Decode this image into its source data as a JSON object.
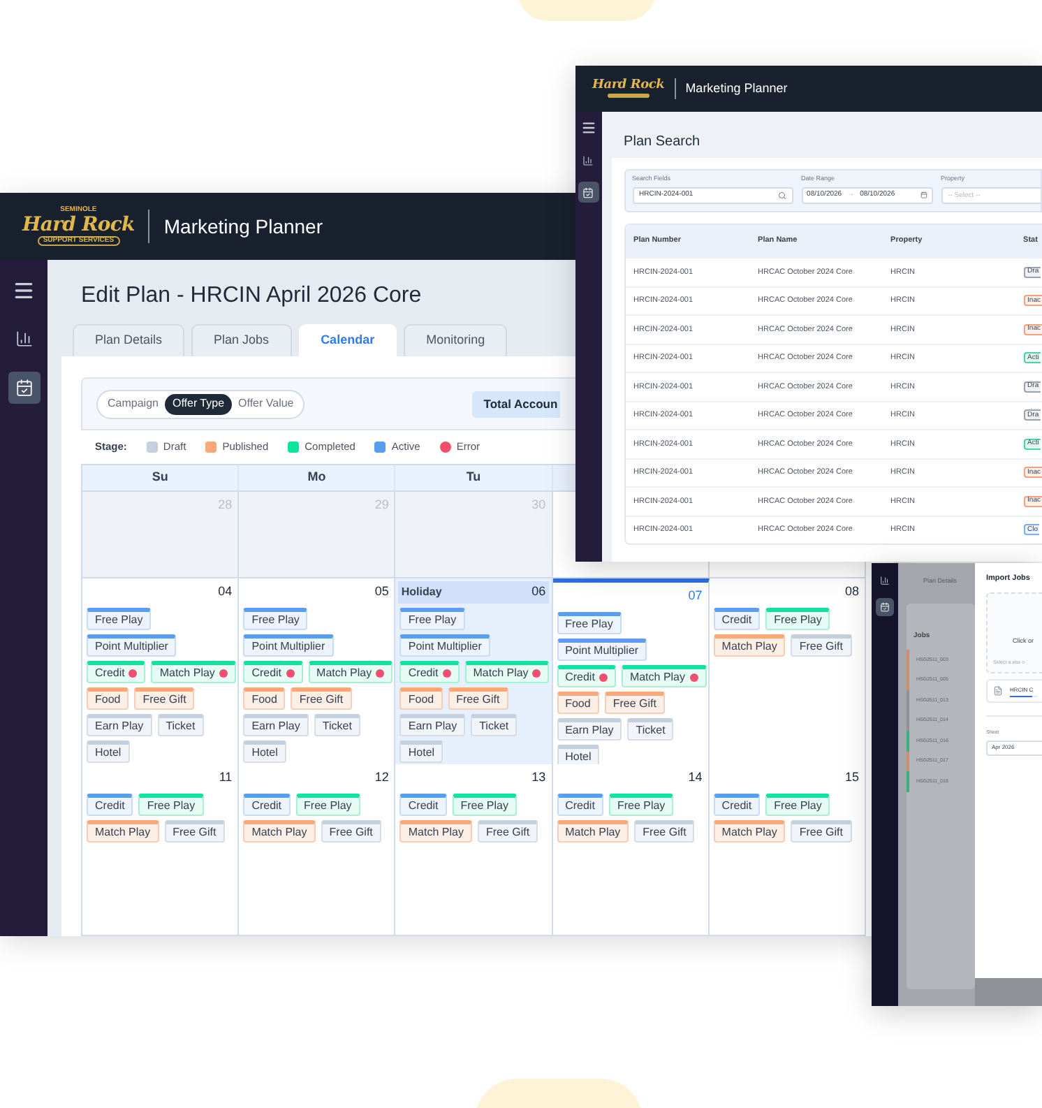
{
  "main_window": {
    "logo": {
      "top": "SEMINOLE",
      "main": "Hard Rock",
      "bottom": "SUPPORT SERVICES"
    },
    "app_title": "Marketing Planner",
    "sidebar": [
      {
        "selected": false
      },
      {
        "selected": false
      },
      {
        "selected": true
      }
    ],
    "page_title": "Edit Plan - HRCIN April 2026 Core",
    "tabs": [
      {
        "label": "Plan Details",
        "selected": false
      },
      {
        "label": "Plan Jobs",
        "selected": false
      },
      {
        "label": "Calendar",
        "selected": true
      },
      {
        "label": "Monitoring",
        "selected": false
      }
    ],
    "view_toggle": [
      {
        "label": "Campaign",
        "selected": false
      },
      {
        "label": "Offer Type",
        "selected": true
      },
      {
        "label": "Offer Value",
        "selected": false
      }
    ],
    "total_button": "Total Accoun",
    "legend": {
      "label": "Stage:",
      "items": [
        {
          "label": "Draft",
          "kind": "draft"
        },
        {
          "label": "Published",
          "kind": "published"
        },
        {
          "label": "Completed",
          "kind": "completed"
        },
        {
          "label": "Active",
          "kind": "active"
        },
        {
          "label": "Error",
          "kind": "error"
        }
      ]
    },
    "weekdays": [
      "Su",
      "Mo",
      "Tu"
    ],
    "weeks": [
      {
        "days": [
          {
            "date": "28",
            "muted": true,
            "today": false
          },
          {
            "date": "29",
            "muted": true,
            "today": false
          },
          {
            "date": "30",
            "muted": true,
            "today": false
          }
        ]
      },
      {
        "days": [
          {
            "date": "04",
            "muted": false,
            "today": false,
            "lines": [
              [
                {
                  "label": "Free Play",
                  "kind": "active",
                  "error": false
                }
              ],
              [
                {
                  "label": "Point Multiplier",
                  "kind": "active",
                  "error": false
                }
              ],
              [
                {
                  "label": "Credit",
                  "kind": "completed",
                  "error": true
                },
                {
                  "label": "Match Play",
                  "kind": "completed",
                  "error": true
                }
              ],
              [
                {
                  "label": "Food",
                  "kind": "published",
                  "error": false
                },
                {
                  "label": "Free Gift",
                  "kind": "published",
                  "error": false
                }
              ],
              [
                {
                  "label": "Earn Play",
                  "kind": "draft",
                  "error": false
                },
                {
                  "label": "Ticket",
                  "kind": "draft",
                  "error": false
                }
              ],
              [
                {
                  "label": "Hotel",
                  "kind": "draft",
                  "error": false
                }
              ]
            ]
          },
          {
            "date": "05",
            "muted": false,
            "today": false,
            "lines": [
              [
                {
                  "label": "Free Play",
                  "kind": "active",
                  "error": false
                }
              ],
              [
                {
                  "label": "Point Multiplier",
                  "kind": "active",
                  "error": false
                }
              ],
              [
                {
                  "label": "Credit",
                  "kind": "completed",
                  "error": true
                },
                {
                  "label": "Match Play",
                  "kind": "completed",
                  "error": true
                }
              ],
              [
                {
                  "label": "Food",
                  "kind": "published",
                  "error": false
                },
                {
                  "label": "Free Gift",
                  "kind": "published",
                  "error": false
                }
              ],
              [
                {
                  "label": "Earn Play",
                  "kind": "draft",
                  "error": false
                },
                {
                  "label": "Ticket",
                  "kind": "draft",
                  "error": false
                }
              ],
              [
                {
                  "label": "Hotel",
                  "kind": "draft",
                  "error": false
                }
              ]
            ]
          },
          {
            "date": "06",
            "holiday": "Holiday",
            "muted": false,
            "today": false,
            "lines": [
              [
                {
                  "label": "Free Play",
                  "kind": "active",
                  "error": false
                }
              ],
              [
                {
                  "label": "Point Multiplier",
                  "kind": "active",
                  "error": false
                }
              ],
              [
                {
                  "label": "Credit",
                  "kind": "completed",
                  "error": true
                },
                {
                  "label": "Match Play",
                  "kind": "completed",
                  "error": true
                }
              ],
              [
                {
                  "label": "Food",
                  "kind": "published",
                  "error": false
                },
                {
                  "label": "Free Gift",
                  "kind": "published",
                  "error": false
                }
              ],
              [
                {
                  "label": "Earn Play",
                  "kind": "draft",
                  "error": false
                },
                {
                  "label": "Ticket",
                  "kind": "draft",
                  "error": false
                }
              ],
              [
                {
                  "label": "Hotel",
                  "kind": "draft",
                  "error": false
                }
              ]
            ]
          },
          {
            "date": "07",
            "muted": false,
            "today": true,
            "lines": [
              [
                {
                  "label": "Free Play",
                  "kind": "active",
                  "error": false
                }
              ],
              [
                {
                  "label": "Point Multiplier",
                  "kind": "active",
                  "error": false
                }
              ],
              [
                {
                  "label": "Credit",
                  "kind": "completed",
                  "error": true
                },
                {
                  "label": "Match Play",
                  "kind": "completed",
                  "error": true
                }
              ],
              [
                {
                  "label": "Food",
                  "kind": "published",
                  "error": false
                },
                {
                  "label": "Free Gift",
                  "kind": "published",
                  "error": false
                }
              ],
              [
                {
                  "label": "Earn Play",
                  "kind": "draft",
                  "error": false
                },
                {
                  "label": "Ticket",
                  "kind": "draft",
                  "error": false
                }
              ],
              [
                {
                  "label": "Hotel",
                  "kind": "draft",
                  "error": false
                }
              ]
            ]
          },
          {
            "date": "08",
            "muted": false,
            "today": false,
            "lines": [
              [
                {
                  "label": "Credit",
                  "kind": "active",
                  "error": false
                },
                {
                  "label": "Free Play",
                  "kind": "completed",
                  "error": false
                }
              ],
              [
                {
                  "label": "Match Play",
                  "kind": "published",
                  "error": false
                },
                {
                  "label": "Free Gift",
                  "kind": "draft",
                  "error": false
                }
              ]
            ]
          }
        ]
      },
      {
        "days": [
          {
            "date": "11",
            "muted": false,
            "today": false,
            "lines": [
              [
                {
                  "label": "Credit",
                  "kind": "active",
                  "error": false
                },
                {
                  "label": "Free Play",
                  "kind": "completed",
                  "error": false
                }
              ],
              [
                {
                  "label": "Match Play",
                  "kind": "published",
                  "error": false
                },
                {
                  "label": "Free Gift",
                  "kind": "draft",
                  "error": false
                }
              ]
            ]
          },
          {
            "date": "12",
            "muted": false,
            "today": false,
            "lines": [
              [
                {
                  "label": "Credit",
                  "kind": "active",
                  "error": false
                },
                {
                  "label": "Free Play",
                  "kind": "completed",
                  "error": false
                }
              ],
              [
                {
                  "label": "Match Play",
                  "kind": "published",
                  "error": false
                },
                {
                  "label": "Free Gift",
                  "kind": "draft",
                  "error": false
                }
              ]
            ]
          },
          {
            "date": "13",
            "muted": false,
            "today": false,
            "lines": [
              [
                {
                  "label": "Credit",
                  "kind": "active",
                  "error": false
                },
                {
                  "label": "Free Play",
                  "kind": "completed",
                  "error": false
                }
              ],
              [
                {
                  "label": "Match Play",
                  "kind": "published",
                  "error": false
                },
                {
                  "label": "Free Gift",
                  "kind": "draft",
                  "error": false
                }
              ]
            ]
          },
          {
            "date": "14",
            "muted": false,
            "today": false,
            "lines": [
              [
                {
                  "label": "Credit",
                  "kind": "active",
                  "error": false
                },
                {
                  "label": "Free Play",
                  "kind": "completed",
                  "error": false
                }
              ],
              [
                {
                  "label": "Match Play",
                  "kind": "published",
                  "error": false
                },
                {
                  "label": "Free Gift",
                  "kind": "draft",
                  "error": false
                }
              ]
            ]
          },
          {
            "date": "15",
            "muted": false,
            "today": false,
            "lines": [
              [
                {
                  "label": "Credit",
                  "kind": "active",
                  "error": false
                },
                {
                  "label": "Free Play",
                  "kind": "completed",
                  "error": false
                }
              ],
              [
                {
                  "label": "Match Play",
                  "kind": "published",
                  "error": false
                },
                {
                  "label": "Free Gift",
                  "kind": "draft",
                  "error": false
                }
              ]
            ]
          }
        ]
      }
    ]
  },
  "search_window": {
    "logo": {
      "main": "Hard Rock"
    },
    "app_title": "Marketing Planner",
    "sidebar": [
      {
        "selected": false
      },
      {
        "selected": false
      },
      {
        "selected": true
      }
    ],
    "page_title": "Plan Search",
    "filters": {
      "search_label": "Search Fields",
      "search_value": "HRCIN-2024-001",
      "date_label": "Date Range",
      "date_from": "08/10/2026",
      "date_arrow": "→",
      "date_to": "08/10/2026",
      "property_label": "Property",
      "property_placeholder": "-- Select --"
    },
    "columns": [
      "Plan Number",
      "Plan Name",
      "Property",
      "Stat"
    ],
    "rows": [
      {
        "number": "HRCIN-2024-001",
        "name": "HRCAC October 2024 Core",
        "property": "HRCIN",
        "status": "Dra",
        "color": "#9aa3ae"
      },
      {
        "number": "HRCIN-2024-001",
        "name": "HRCAC October 2024 Core",
        "property": "HRCIN",
        "status": "Inac",
        "color": "#f3a27c"
      },
      {
        "number": "HRCIN-2024-001",
        "name": "HRCAC October 2024 Core",
        "property": "HRCIN",
        "status": "Inac",
        "color": "#f3a27c"
      },
      {
        "number": "HRCIN-2024-001",
        "name": "HRCAC October 2024 Core",
        "property": "HRCIN",
        "status": "Acti",
        "color": "#48d6a4"
      },
      {
        "number": "HRCIN-2024-001",
        "name": "HRCAC October 2024 Core",
        "property": "HRCIN",
        "status": "Dra",
        "color": "#9aa3ae"
      },
      {
        "number": "HRCIN-2024-001",
        "name": "HRCAC October 2024 Core",
        "property": "HRCIN",
        "status": "Dra",
        "color": "#9aa3ae"
      },
      {
        "number": "HRCIN-2024-001",
        "name": "HRCAC October 2024 Core",
        "property": "HRCIN",
        "status": "Acti",
        "color": "#48d6a4"
      },
      {
        "number": "HRCIN-2024-001",
        "name": "HRCAC October 2024 Core",
        "property": "HRCIN",
        "status": "Inac",
        "color": "#f3a27c"
      },
      {
        "number": "HRCIN-2024-001",
        "name": "HRCAC October 2024 Core",
        "property": "HRCIN",
        "status": "Inac",
        "color": "#f3a27c"
      },
      {
        "number": "HRCIN-2024-001",
        "name": "HRCAC October 2024 Core",
        "property": "HRCIN",
        "status": "Clo",
        "color": "#7fb0ee"
      }
    ]
  },
  "import_window": {
    "sidebar": [
      {
        "selected": false
      },
      {
        "selected": true
      }
    ],
    "tab": "Plan Details",
    "jobs_title": "Jobs",
    "jobs": [
      {
        "label": "HSG2511_003",
        "color": "#c98f70"
      },
      {
        "label": "HSG2511_005",
        "color": "#c98f70"
      },
      {
        "label": "HSG2511_013",
        "color": "#8d9299"
      },
      {
        "label": "HSG2511_014",
        "color": "#8d9299"
      },
      {
        "label": "HSG2511_016",
        "color": "#3fae83"
      },
      {
        "label": "HSG2511_017",
        "color": "#c98f70"
      },
      {
        "label": "HSG2511_018",
        "color": "#3fae83"
      }
    ],
    "modal": {
      "title": "Import Jobs",
      "drop_text": "Click or",
      "drop_hint": "Select a xlsx o",
      "file_name": "HRCIN C",
      "upload": {
        "level": 0.8
      },
      "sheet_label": "Sheet",
      "sheet_value": "Apr 2026"
    }
  }
}
